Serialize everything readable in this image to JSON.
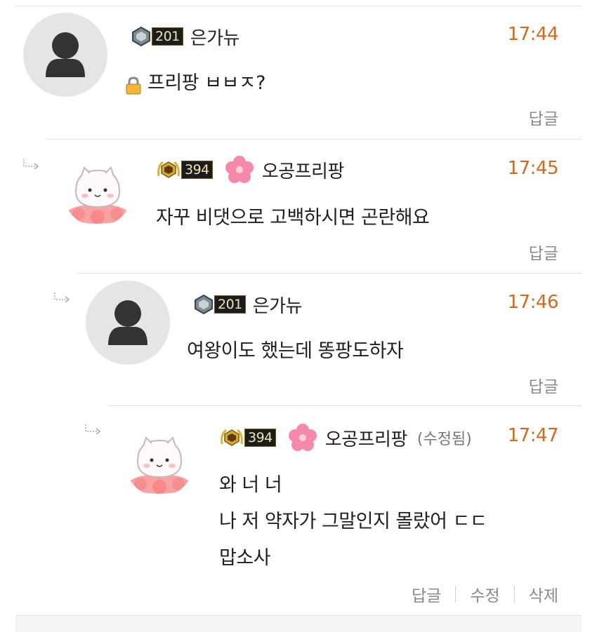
{
  "comments": [
    {
      "level": "201",
      "nickname": "은가뉴",
      "time": "17:44",
      "text_lines": [
        "프리팡 ㅂㅂㅈ?"
      ],
      "reply_label": "답글",
      "locked": true
    },
    {
      "level": "394",
      "nickname": "오공프리팡",
      "time": "17:45",
      "text_lines": [
        "자꾸 비댓으로 고백하시면 곤란해요"
      ],
      "reply_label": "답글"
    },
    {
      "level": "201",
      "nickname": "은가뉴",
      "time": "17:46",
      "text_lines": [
        "여왕이도 했는데 똥팡도하자"
      ],
      "reply_label": "답글"
    },
    {
      "level": "394",
      "nickname": "오공프리팡",
      "edited_label": "(수정됨)",
      "time": "17:47",
      "text_lines": [
        "와 너 너",
        "나 저 약자가 그말인지 몰랐어 ㄷㄷ",
        "맙소사"
      ],
      "reply_label": "답글",
      "edit_label": "수정",
      "delete_label": "삭제"
    }
  ],
  "colors": {
    "time": "#d2691e",
    "action": "#8a8a8a",
    "avatar_bg": "#e5e5e7",
    "flower": "#f58aa8"
  }
}
